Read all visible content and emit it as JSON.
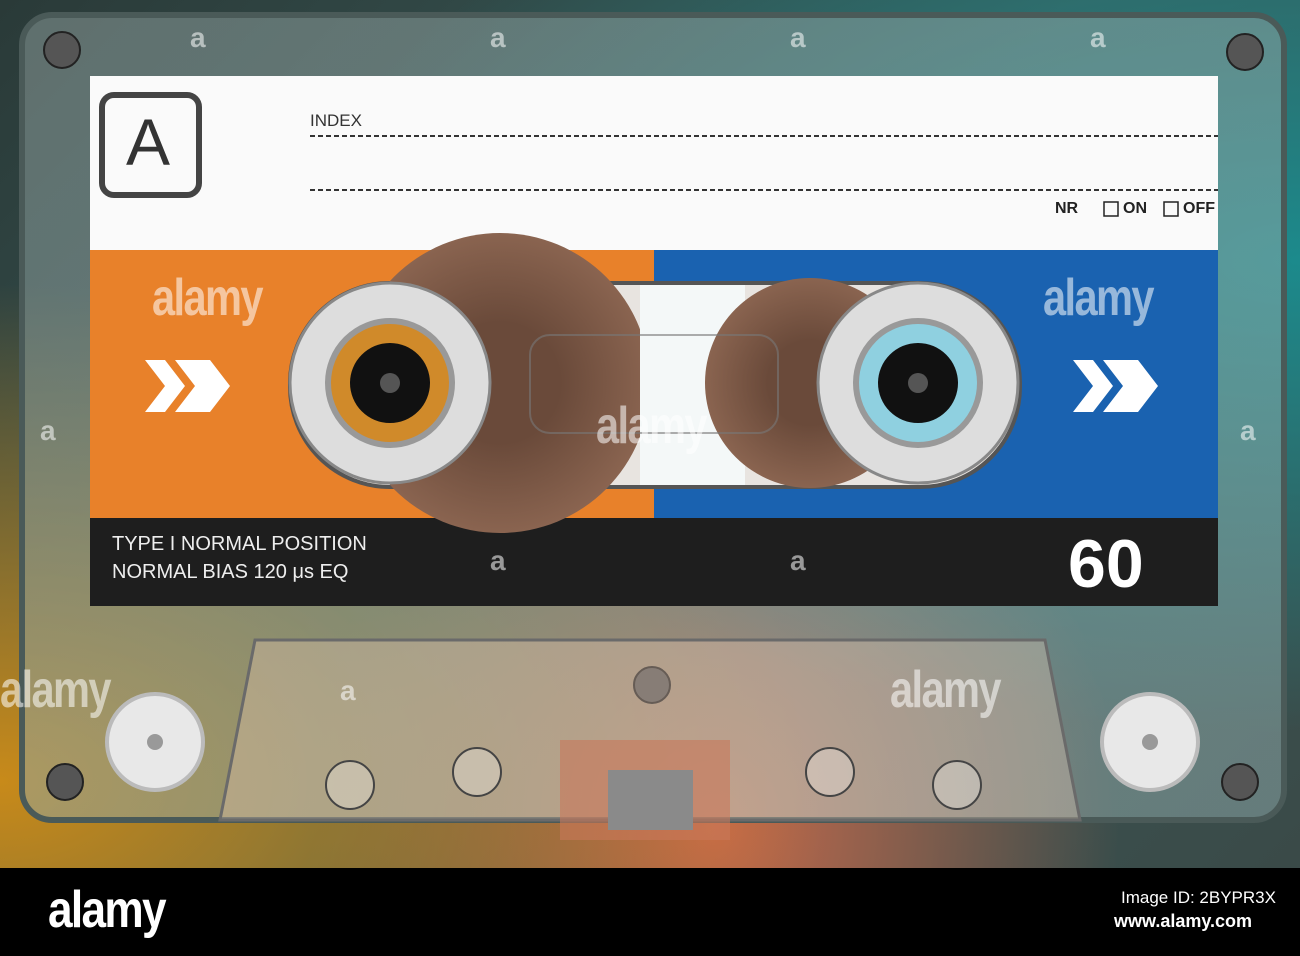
{
  "label": {
    "side": "A",
    "index_label": "INDEX",
    "nr_label": "NR",
    "nr_on": "ON",
    "nr_off": "OFF",
    "type_line1": "TYPE I NORMAL POSITION",
    "type_line2": "NORMAL BIAS 120 μs EQ",
    "length": "60",
    "colors": {
      "left_panel": "#e8812a",
      "right_panel": "#1a62b0",
      "strip": "#1e1e1e"
    }
  },
  "watermark": {
    "text": "alamy",
    "small": "a"
  },
  "footer": {
    "logo": "alamy",
    "image_id": "Image ID: 2BYPR3X",
    "url": "www.alamy.com"
  }
}
